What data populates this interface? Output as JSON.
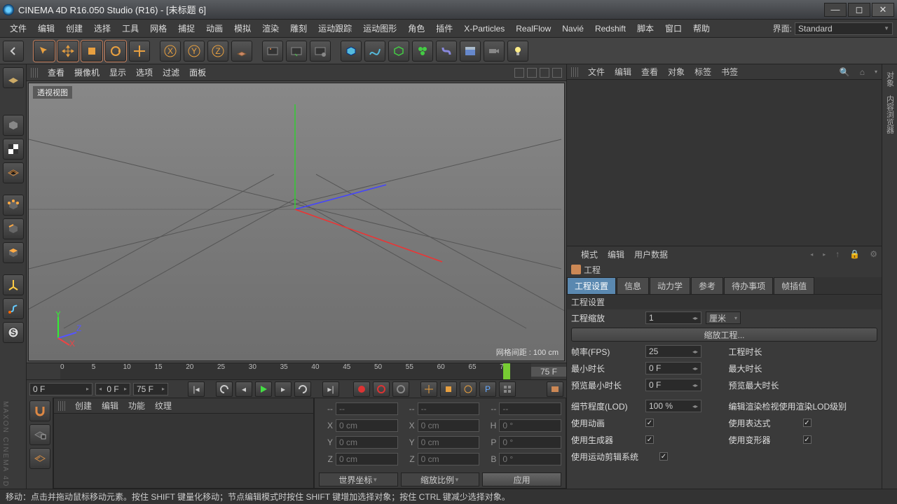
{
  "window": {
    "title": "CINEMA 4D R16.050 Studio (R16) - [未标题 6]"
  },
  "layout": {
    "label": "界面:",
    "value": "Standard"
  },
  "menubar": [
    "文件",
    "编辑",
    "创建",
    "选择",
    "工具",
    "网格",
    "捕捉",
    "动画",
    "模拟",
    "渲染",
    "雕刻",
    "运动跟踪",
    "运动图形",
    "角色",
    "插件",
    "X-Particles",
    "RealFlow",
    "Navié",
    "Redshift",
    "脚本",
    "窗口",
    "帮助"
  ],
  "viewmenu": [
    "查看",
    "摄像机",
    "显示",
    "选项",
    "过滤",
    "面板"
  ],
  "viewport": {
    "label": "透视视图",
    "gridinfo": "网格间距 : 100 cm"
  },
  "timeline": {
    "start": "0 F",
    "curA": "0 F",
    "curB": "75 F",
    "endlabel": "75 F",
    "ticks": [
      0,
      5,
      10,
      15,
      20,
      25,
      30,
      35,
      40,
      45,
      50,
      55,
      60,
      65,
      70
    ]
  },
  "objmenu": [
    "文件",
    "编辑",
    "查看",
    "对象",
    "标签",
    "书签"
  ],
  "attrmenu": [
    "模式",
    "编辑",
    "用户数据"
  ],
  "attr": {
    "title": "工程",
    "tabs": [
      "工程设置",
      "信息",
      "动力学",
      "参考",
      "待办事项",
      "帧插值"
    ],
    "section": "工程设置",
    "scale_label": "工程缩放",
    "scale_val": "1",
    "scale_unit": "厘米",
    "scalebtn": "缩放工程...",
    "fps_label": "帧率(FPS)",
    "fps_val": "25",
    "projtime_label": "工程时长",
    "mintime_label": "最小时长",
    "mintime_val": "0 F",
    "maxtime_label": "最大时长",
    "prevmin_label": "预览最小时长",
    "prevmin_val": "0 F",
    "prevmax_label": "预览最大时长",
    "lod_label": "细节程度(LOD)",
    "lod_val": "100 %",
    "lod2_label": "编辑渲染检视使用渲染LOD级别",
    "useanim_label": "使用动画",
    "useexpr_label": "使用表达式",
    "usegen_label": "使用生成器",
    "usedef_label": "使用变形器",
    "usemot_label": "使用运动剪辑系统"
  },
  "matmenu": [
    "创建",
    "编辑",
    "功能",
    "纹理"
  ],
  "coords": {
    "blank": "--",
    "x": "X",
    "y": "Y",
    "z": "Z",
    "h": "H",
    "p": "P",
    "b": "B",
    "cm": "0 cm",
    "deg": "0 °",
    "world": "世界坐标",
    "scalemode": "缩放比例",
    "apply": "应用"
  },
  "status": "移动：点击并拖动鼠标移动元素。按住 SHIFT 键量化移动；节点编辑模式时按住 SHIFT 键增加选择对象；按住 CTRL 键减少选择对象。"
}
